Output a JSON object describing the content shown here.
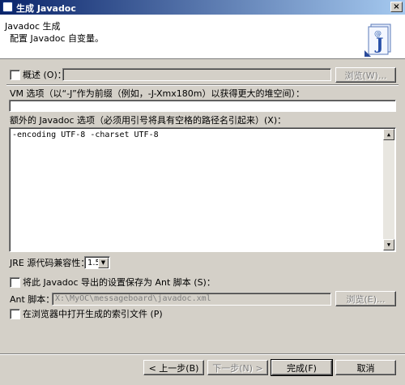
{
  "window": {
    "title": "生成 Javadoc",
    "close_glyph": "×"
  },
  "header": {
    "title": "Javadoc 生成",
    "description": "配置 Javadoc 自变量。"
  },
  "overview": {
    "label": "概述 (O)：",
    "checked": false,
    "value": "",
    "browse_label": "浏览(W)..."
  },
  "vm_options": {
    "label": "VM 选项（以“-J”作为前缀（例如，-J-Xmx180m）以获得更大的堆空间）：",
    "value": ""
  },
  "extra_options": {
    "label": "额外的 Javadoc 选项（必须用引号将具有空格的路径名引起来）(X)：",
    "value": "-encoding UTF-8 -charset UTF-8"
  },
  "jre": {
    "label": "JRE 源代码兼容性：",
    "value": "1.5"
  },
  "save_ant": {
    "label": "将此 Javadoc 导出的设置保存为 Ant 脚本 (S)：",
    "checked": false
  },
  "ant_script": {
    "label": "Ant 脚本：",
    "value": "X:\\MyOC\\messageboard\\javadoc.xml",
    "browse_label": "浏览(E)..."
  },
  "open_browser": {
    "label": "在浏览器中打开生成的索引文件 (P)",
    "checked": false
  },
  "buttons": {
    "back": "< 上一步(B)",
    "next": "下一步(N) >",
    "finish": "完成(F)",
    "cancel": "取消"
  }
}
